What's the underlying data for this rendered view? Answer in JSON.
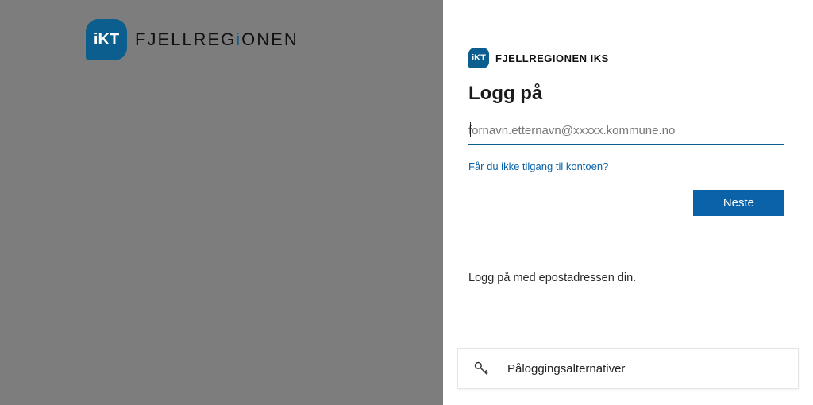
{
  "brand": {
    "badge_text": "iKT",
    "name_html": "FJELLREGIONEN"
  },
  "org": {
    "badge_text": "iKT",
    "name": "FJELLREGIONEN IKS"
  },
  "login": {
    "heading": "Logg på",
    "email_placeholder": "fornavn.etternavn@xxxxx.kommune.no",
    "help_link": "Får du ikke tilgang til kontoen?",
    "next_label": "Neste",
    "hint": "Logg på med epostadressen din."
  },
  "alt": {
    "label": "Påloggingsalternativer"
  }
}
